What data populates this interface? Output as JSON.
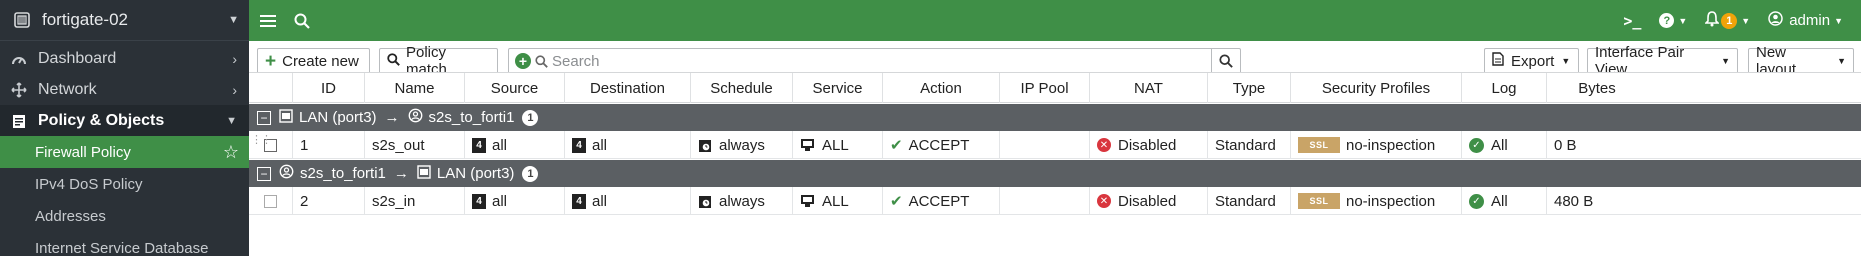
{
  "sidebar": {
    "device_name": "fortigate-02",
    "items": [
      {
        "label": "Dashboard",
        "icon": "dashboard-icon"
      },
      {
        "label": "Network",
        "icon": "network-icon"
      },
      {
        "label": "Policy & Objects",
        "icon": "policy-icon"
      }
    ],
    "sub_items": [
      {
        "label": "Firewall Policy"
      },
      {
        "label": "IPv4 DoS Policy"
      },
      {
        "label": "Addresses"
      },
      {
        "label": "Internet Service Database"
      }
    ]
  },
  "topbar": {
    "notifications_count": "1",
    "user": "admin"
  },
  "toolbar": {
    "create_new": "Create new",
    "policy_match": "Policy match",
    "search_placeholder": "Search",
    "export": "Export",
    "view": "Interface Pair View",
    "new_layout": "New layout"
  },
  "columns": [
    "ID",
    "Name",
    "Source",
    "Destination",
    "Schedule",
    "Service",
    "Action",
    "IP Pool",
    "NAT",
    "Type",
    "Security Profiles",
    "Log",
    "Bytes"
  ],
  "groups": [
    {
      "from": "LAN (port3)",
      "to": "s2s_to_forti1",
      "count": "1",
      "rows": [
        {
          "id": "1",
          "name": "s2s_out",
          "source": "all",
          "destination": "all",
          "schedule": "always",
          "service": "ALL",
          "action": "ACCEPT",
          "ip_pool": "",
          "nat": "Disabled",
          "type": "Standard",
          "ssl_badge": "SSL",
          "profile": "no-inspection",
          "log": "All",
          "bytes": "0 B"
        }
      ]
    },
    {
      "from": "s2s_to_forti1",
      "to": "LAN (port3)",
      "count": "1",
      "rows": [
        {
          "id": "2",
          "name": "s2s_in",
          "source": "all",
          "destination": "all",
          "schedule": "always",
          "service": "ALL",
          "action": "ACCEPT",
          "ip_pool": "",
          "nat": "Disabled",
          "type": "Standard",
          "ssl_badge": "SSL",
          "profile": "no-inspection",
          "log": "All",
          "bytes": "480 B"
        }
      ]
    }
  ],
  "colors": {
    "brand_green": "#3f8f47",
    "sidebar_bg": "#2b3137",
    "group_bg": "#5b5f63"
  }
}
